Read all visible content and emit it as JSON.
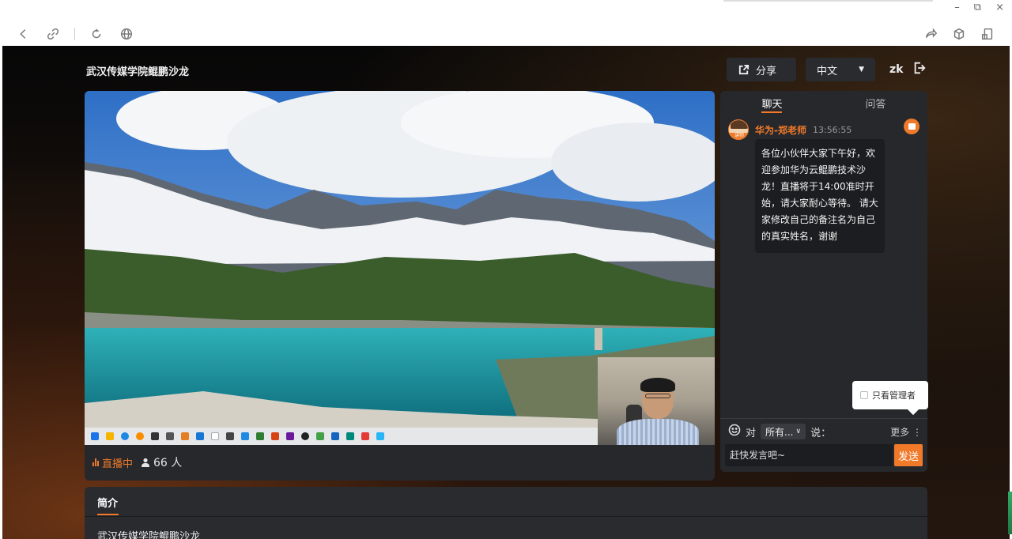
{
  "window": {
    "min": "–",
    "restore": "⧉",
    "close": "×"
  },
  "room": {
    "title": "武汉传媒学院鲲鹏沙龙"
  },
  "topbar": {
    "share_label": "分享",
    "lang_label": "中文",
    "user": "zk"
  },
  "player": {
    "live_label": "直播中",
    "viewers": "66 人"
  },
  "chat": {
    "tabs": [
      {
        "label": "聊天"
      },
      {
        "label": "问答"
      }
    ],
    "message": {
      "sender": "华为-郑老师",
      "time": "13:56:55",
      "role_tag": "讲师",
      "text": "各位小伙伴大家下午好，欢迎参加华为云鲲鹏技术沙龙！直播将于14:00准时开始，请大家耐心等待。 请大家修改自己的备注名为自己的真实姓名，谢谢"
    },
    "filter_popup": {
      "label": "只看管理者"
    },
    "to_label": "对",
    "target_select": "所有...",
    "say_label": "说：",
    "more_label": "更多",
    "input_placeholder": "赶快发言吧~",
    "send_label": "发送"
  },
  "intro": {
    "tab_label": "简介",
    "body": "武汉传媒学院鲲鹏沙龙"
  },
  "colors": {
    "accent": "#f07a2a",
    "panel": "#27282c"
  }
}
